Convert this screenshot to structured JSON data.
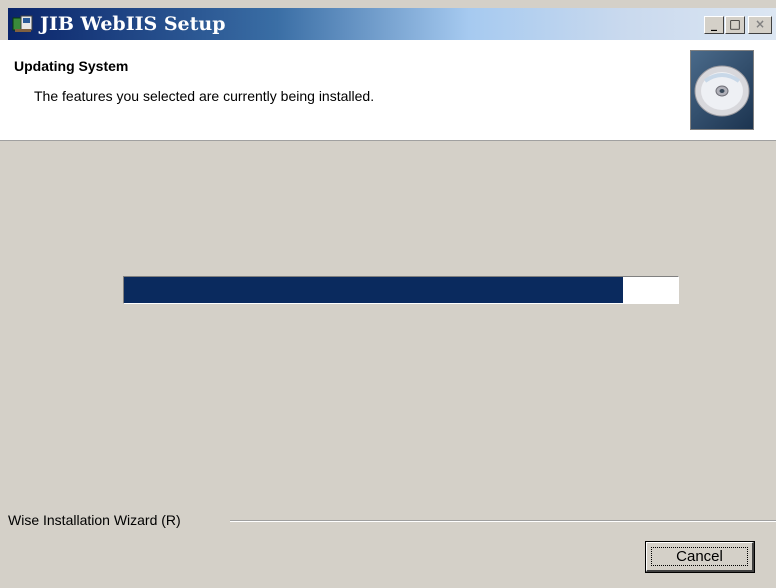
{
  "window": {
    "title": "JIB WebIIS Setup",
    "icon": "setup-icon",
    "controls": {
      "minimize": "_",
      "maximize": "□",
      "close": "×"
    }
  },
  "header": {
    "title": "Updating System",
    "subtitle": "The features you selected are currently being installed.",
    "graphic": "cd-disc-icon"
  },
  "progress": {
    "fraction": 0.9,
    "color": "#0a2a5e"
  },
  "footer": {
    "brand": "Wise Installation Wizard (R)",
    "cancel_label": "Cancel"
  }
}
